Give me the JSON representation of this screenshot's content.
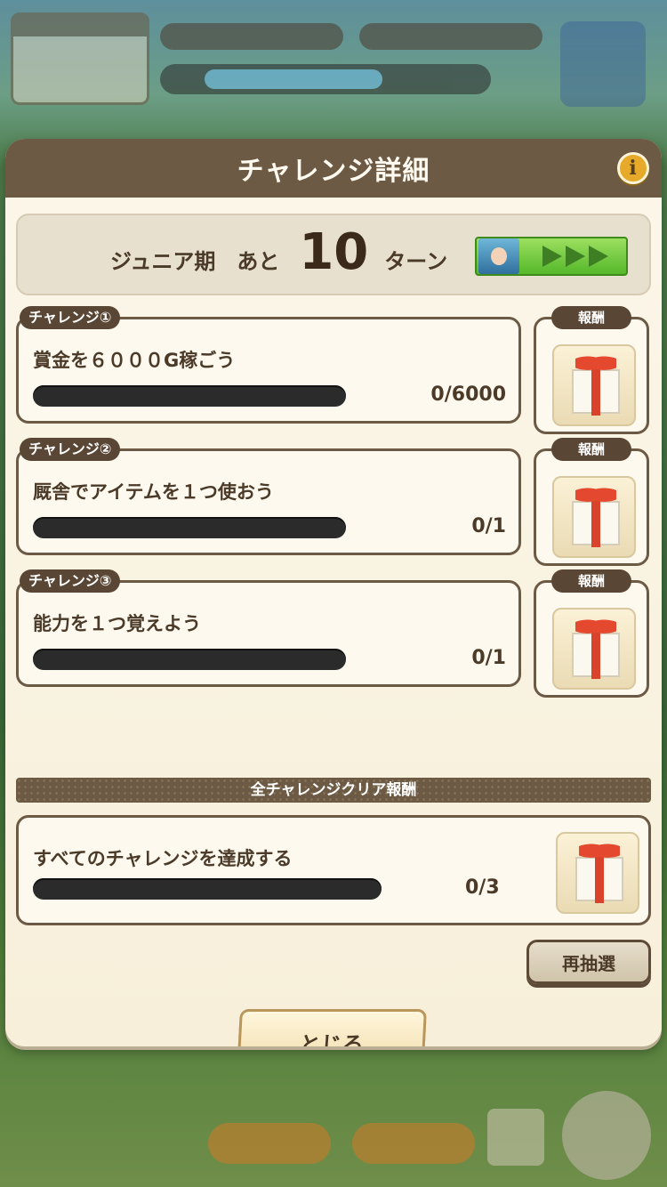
{
  "modal": {
    "title": "チャレンジ詳細",
    "info_icon_label": "i"
  },
  "turn_banner": {
    "prefix": "ジュニア期　あと",
    "turns_left": "10",
    "suffix": "ターン"
  },
  "challenges": [
    {
      "tag": "チャレンジ①",
      "title": "賞金を６０００G稼ごう",
      "count": "0/6000",
      "progress": 0
    },
    {
      "tag": "チャレンジ②",
      "title": "厩舎でアイテムを１つ使おう",
      "count": "0/1",
      "progress": 0
    },
    {
      "tag": "チャレンジ③",
      "title": "能力を１つ覚えよう",
      "count": "0/1",
      "progress": 0
    }
  ],
  "reward_label": "報酬",
  "all_clear": {
    "banner": "全チャレンジクリア報酬",
    "title": "すべてのチャレンジを達成する",
    "count": "0/3",
    "progress": 0
  },
  "buttons": {
    "redraw": "再抽選",
    "close": "とじる"
  },
  "icons": {
    "reward": "gift-box-icon",
    "info": "info-icon",
    "trainer": "trainer-portrait-icon",
    "phase": "phase-arrow-icon"
  },
  "colors": {
    "header": "#6d5a45",
    "panel": "#f6f0df",
    "bar_track": "#2b2b2b",
    "phase_green": "#55b82a",
    "gift_ribbon": "#d9432b"
  }
}
